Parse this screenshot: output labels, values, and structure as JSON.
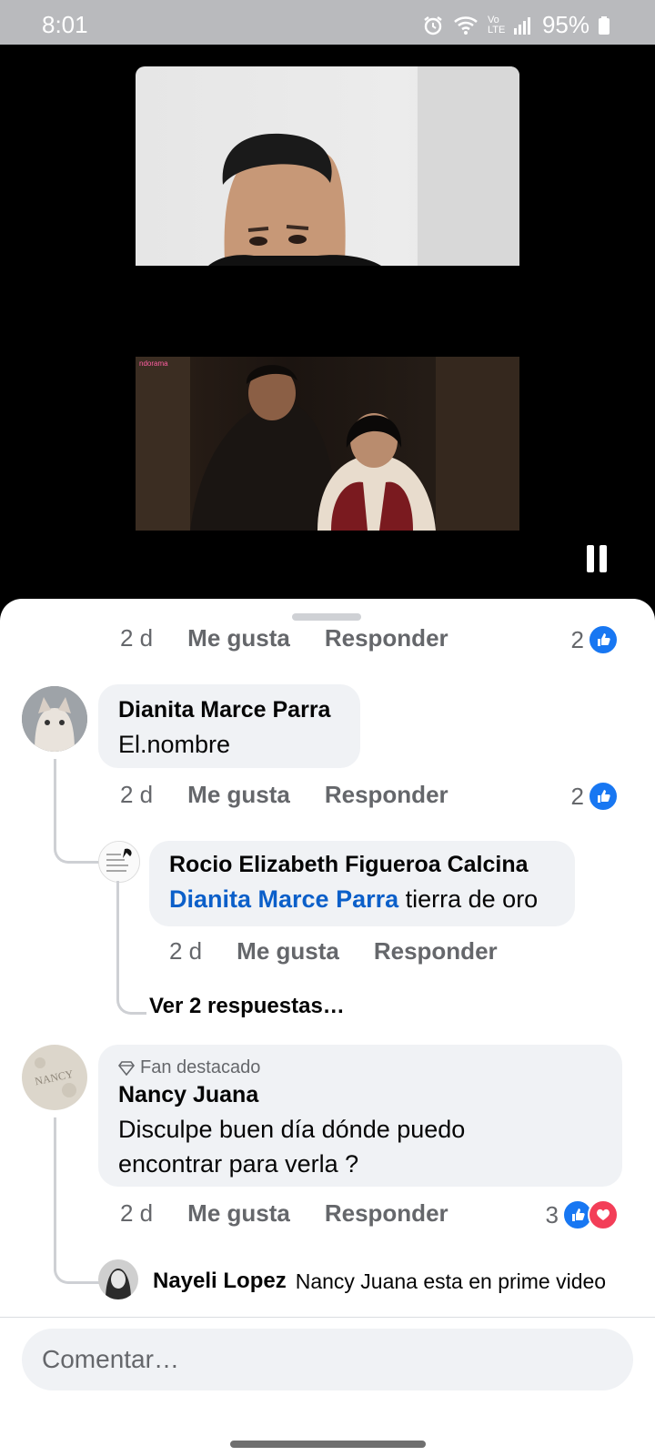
{
  "status_bar": {
    "time": "8:01",
    "network": "Vo LTE",
    "battery": "95%"
  },
  "video": {
    "pause_icon": "pause-icon",
    "watermark": "ndorama"
  },
  "comments": {
    "top_meta": {
      "age": "2 d",
      "like": "Me gusta",
      "reply": "Responder",
      "count": "2"
    },
    "c1": {
      "name": "Dianita Marce Parra",
      "text": "El.nombre",
      "age": "2 d",
      "like": "Me gusta",
      "reply": "Responder",
      "count": "2"
    },
    "c1_reply": {
      "name": "Rocio Elizabeth Figueroa Calcina",
      "mention": "Dianita Marce Parra",
      "text": " tierra de oro",
      "age": "2 d",
      "like": "Me gusta",
      "reply": "Responder"
    },
    "c1_more": "Ver 2 respuestas…",
    "c2": {
      "badge": "Fan destacado",
      "name": "Nancy Juana",
      "text_line1": "Disculpe buen día dónde puedo",
      "text_line2": "encontrar  para verla ?",
      "age": "2 d",
      "like": "Me gusta",
      "reply": "Responder",
      "count": "3"
    },
    "c2_reply": {
      "name": "Nayeli Lopez",
      "text": "Nancy Juana esta en prime video"
    }
  },
  "composer": {
    "placeholder": "Comentar…"
  },
  "colors": {
    "accent": "#1877f2",
    "heart": "#f33e58",
    "bubble": "#f0f2f5",
    "mention": "#0b5fc9"
  }
}
